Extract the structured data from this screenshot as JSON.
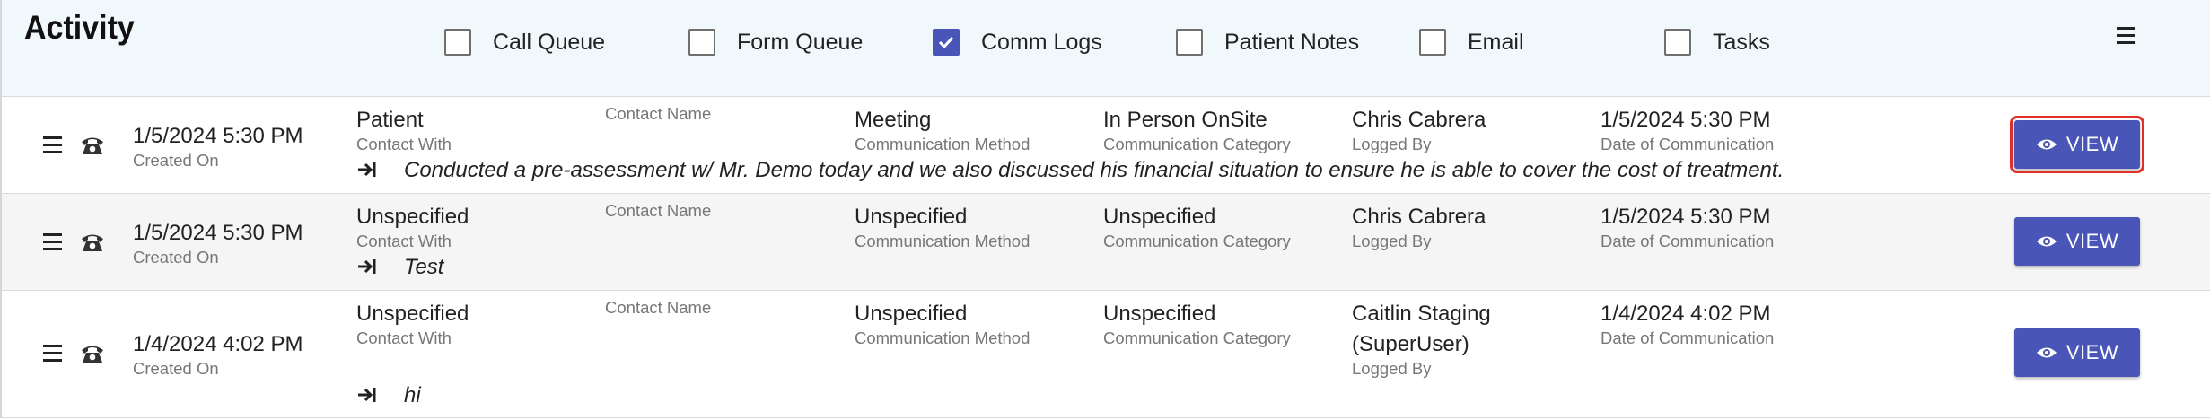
{
  "header": {
    "title": "Activity",
    "filters": [
      {
        "label": "Call Queue",
        "checked": false
      },
      {
        "label": "Form Queue",
        "checked": false
      },
      {
        "label": "Comm Logs",
        "checked": true
      },
      {
        "label": "Patient Notes",
        "checked": false
      },
      {
        "label": "Email",
        "checked": false
      },
      {
        "label": "Tasks",
        "checked": false
      }
    ]
  },
  "labels": {
    "created_on": "Created On",
    "contact_with": "Contact With",
    "contact_name": "Contact Name",
    "communication_method": "Communication Method",
    "communication_category": "Communication Category",
    "logged_by": "Logged By",
    "date_of_communication": "Date of Communication",
    "view": "VIEW"
  },
  "rows": [
    {
      "created": "1/5/2024 5:30 PM",
      "contact_with": "Patient",
      "contact_name": "",
      "method": "Meeting",
      "category": "In Person OnSite",
      "logged_by": "Chris Cabrera",
      "date": "1/5/2024 5:30 PM",
      "note": "Conducted a pre-assessment w/ Mr. Demo today and we also discussed his financial situation to ensure he is able to cover the cost of treatment.",
      "selected": true
    },
    {
      "created": "1/5/2024 5:30 PM",
      "contact_with": "Unspecified",
      "contact_name": "",
      "method": "Unspecified",
      "category": "Unspecified",
      "logged_by": "Chris Cabrera",
      "date": "1/5/2024 5:30 PM",
      "note": "Test",
      "selected": false
    },
    {
      "created": "1/4/2024 4:02 PM",
      "contact_with": "Unspecified",
      "contact_name": "",
      "method": "Unspecified",
      "category": "Unspecified",
      "logged_by_line1": "Caitlin Staging",
      "logged_by_line2": "(SuperUser)",
      "date": "1/4/2024 4:02 PM",
      "note": "hi",
      "selected": false
    }
  ],
  "colors": {
    "accent": "#4a55b8",
    "selection_outline": "#e03128",
    "header_bg": "#f1f8fc",
    "alt_row_bg": "#f5f5f5"
  },
  "icons": {
    "row_menu": "hamburger-icon",
    "comm_type": "telephone-icon",
    "note": "arrow-right-to-bar-icon",
    "view": "eye-icon",
    "header_menu": "hamburger-icon"
  }
}
